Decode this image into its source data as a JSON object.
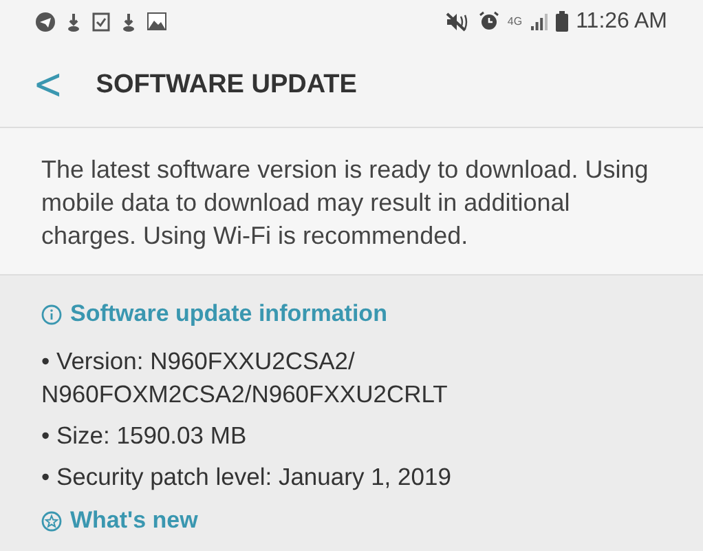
{
  "status_bar": {
    "time": "11:26 AM",
    "network": "4G"
  },
  "header": {
    "back": "<",
    "title": "SOFTWARE UPDATE"
  },
  "description": "The latest software version is ready to download. Using mobile data to download may result in additional charges. Using Wi-Fi is recommended.",
  "info_section": {
    "title": "Software update information",
    "items": [
      "• Version: N960FXXU2CSA2/ N960FOXM2CSA2/N960FXXU2CRLT",
      "• Size: 1590.03 MB",
      "• Security patch level: January 1, 2019"
    ]
  },
  "whats_new": {
    "title": "What's new"
  }
}
